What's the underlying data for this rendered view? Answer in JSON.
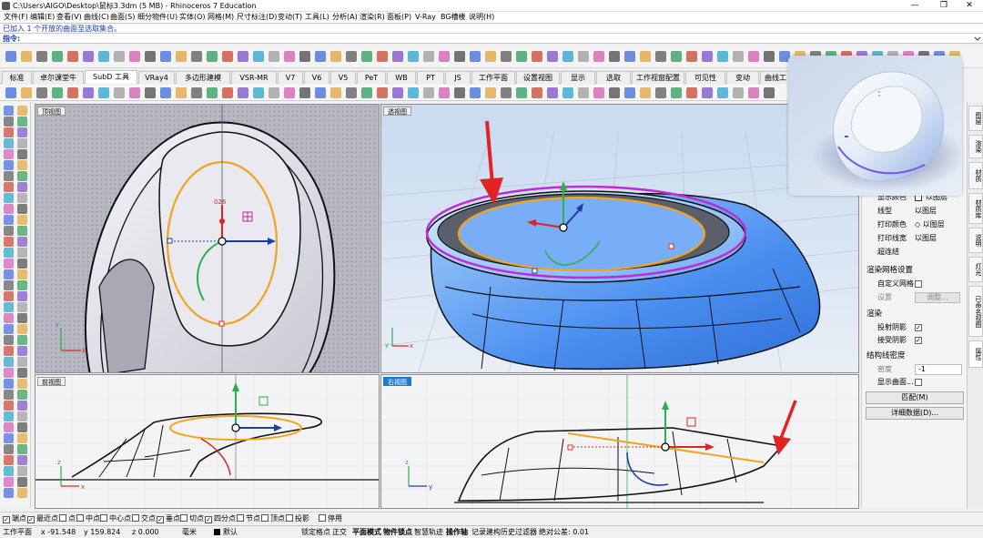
{
  "window": {
    "title": "C:\\Users\\AIGO\\Desktop\\鼠标3.3dm (5 MB) - Rhinoceros 7 Education",
    "minimize": "—",
    "maximize": "❐",
    "close": "✕"
  },
  "menu": [
    "文件(F)",
    "编辑(E)",
    "查看(V)",
    "曲线(C)",
    "曲面(S)",
    "细分物件(U)",
    "实体(O)",
    "网格(M)",
    "尺寸标注(D)",
    "变动(T)",
    "工具(L)",
    "分析(A)",
    "渲染(R)",
    "面板(P)",
    "V-Ray",
    "BG槽楼",
    "说明(H)"
  ],
  "command": {
    "history": "已加入 1 个开放的曲面至选取集合。",
    "prompt": "指令:"
  },
  "tabs": [
    "标准",
    "卓尔课堂牛",
    "SubD 工具",
    "VRay4",
    "多边形建模",
    "VSR-MR",
    "V7",
    "V6",
    "V5",
    "PeT",
    "WB",
    "PT",
    "JS",
    "工作平面",
    "设置视图",
    "显示",
    "选取",
    "工作视窗配置",
    "可见性",
    "变动",
    "曲线工"
  ],
  "active_tab": "SubD 工具",
  "viewports": {
    "top": {
      "label": "顶视图",
      "dim": "026"
    },
    "persp": {
      "label": "透视图"
    },
    "front": {
      "label": "前视图"
    },
    "right": {
      "label": "右视图"
    }
  },
  "axes": {
    "x": "x",
    "y": "y",
    "z": "z"
  },
  "properties": {
    "rows": [
      {
        "k": "显示颜色",
        "v": "以图层"
      },
      {
        "k": "线型",
        "v": "以图层"
      },
      {
        "k": "打印颜色",
        "v": "◇ 以图层"
      },
      {
        "k": "打印线宽",
        "v": "以图层"
      },
      {
        "k": "超连结",
        "v": ""
      }
    ],
    "mesh_header": "渲染网格设置",
    "custom_mesh": "自定义网格",
    "settings": "设置",
    "adjust": "调整...",
    "render_header": "渲染",
    "cast_shadow": "投射阴影",
    "recv_shadow": "接受阴影",
    "iso_header": "结构线密度",
    "density": "密度",
    "density_val": "-1",
    "show_surface": "显示曲面...",
    "match_btn": "匹配(M)",
    "details_btn": "详细数据(D)..."
  },
  "sidetabs": [
    "图层",
    "渲染",
    "材质",
    "材质库",
    "说明",
    "灯光",
    "已命名视图",
    "属性"
  ],
  "osnap": [
    {
      "label": "端点",
      "checked": true
    },
    {
      "label": "最近点",
      "checked": true
    },
    {
      "label": "点",
      "checked": false
    },
    {
      "label": "中点",
      "checked": false
    },
    {
      "label": "中心点",
      "checked": false
    },
    {
      "label": "交点",
      "checked": false
    },
    {
      "label": "垂点",
      "checked": true
    },
    {
      "label": "切点",
      "checked": false
    },
    {
      "label": "四分点",
      "checked": true
    },
    {
      "label": "节点",
      "checked": false
    },
    {
      "label": "顶点",
      "checked": false
    },
    {
      "label": "投影",
      "checked": false
    },
    {
      "label": "停用",
      "checked": false
    }
  ],
  "status": {
    "cplane": "工作平面",
    "x": "x -91.548",
    "y": "y 159.824",
    "z": "z 0.000",
    "units": "毫米",
    "layer": "默认",
    "grid_snap": "锁定格点",
    "ortho": "正交",
    "planar": "平面模式",
    "osnap": "物件锁点",
    "smarttrack": "智慧轨迹",
    "gumball": "操作轴",
    "history": "记录建构历史",
    "filter": "过滤器",
    "tolerance": "绝对公差: 0.01"
  },
  "colors": {
    "accent": "#1e7bd4",
    "select": "#f2a51c",
    "magenta": "#c02bd8",
    "arrow": "#e02424"
  }
}
